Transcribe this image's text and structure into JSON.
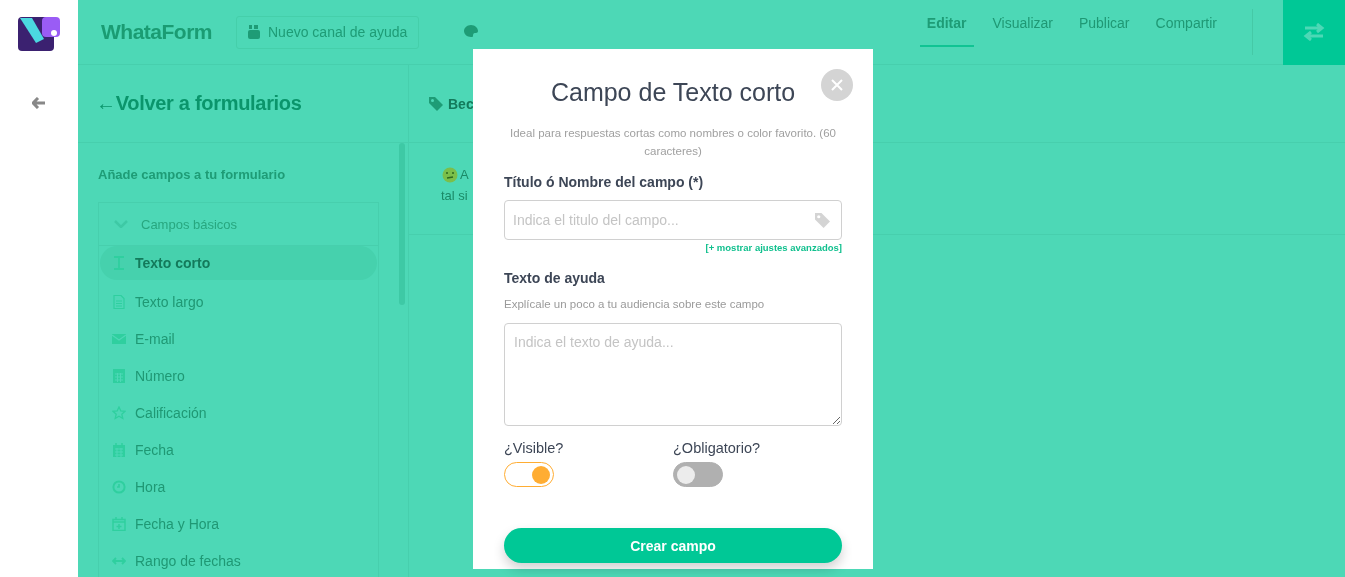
{
  "header": {
    "brand": "WhataForm",
    "help_button": "Nuevo canal de ayuda",
    "tabs": [
      {
        "label": "Editar",
        "selected": true
      },
      {
        "label": "Visualizar",
        "selected": false
      },
      {
        "label": "Publicar",
        "selected": false
      },
      {
        "label": "Compartir",
        "selected": false
      }
    ]
  },
  "sidebar": {
    "back_link": "←Volver a formularios",
    "heading": "Añade campos a tu formulario",
    "group": {
      "label": "Campos básicos",
      "expanded": true
    },
    "items": [
      {
        "label": "Texto corto",
        "selected": true
      },
      {
        "label": "Texto largo",
        "selected": false
      },
      {
        "label": "E-mail",
        "selected": false
      },
      {
        "label": "Número",
        "selected": false
      },
      {
        "label": "Calificación",
        "selected": false
      },
      {
        "label": "Fecha",
        "selected": false
      },
      {
        "label": "Hora",
        "selected": false
      },
      {
        "label": "Fecha y Hora",
        "selected": false
      },
      {
        "label": "Rango de fechas",
        "selected": false
      }
    ]
  },
  "content": {
    "title": "Bec",
    "note_lines": [
      "A",
      "tal si"
    ]
  },
  "modal": {
    "title": "Campo de Texto corto",
    "description": "Ideal para respuestas cortas como nombres o color favorito. (60 caracteres)",
    "name_label": "Título ó Nombre del campo (*)",
    "name_placeholder": "Indica el titulo del campo...",
    "advanced_link": "[+ mostrar ajustes avanzados]",
    "help_label": "Texto de ayuda",
    "help_hint": "Explícale un poco a tu audiencia sobre este campo",
    "help_placeholder": "Indica el texto de ayuda...",
    "toggles": [
      {
        "label": "¿Visible?",
        "on": true
      },
      {
        "label": "¿Obligatorio?",
        "on": false
      }
    ],
    "submit": "Crear campo"
  }
}
